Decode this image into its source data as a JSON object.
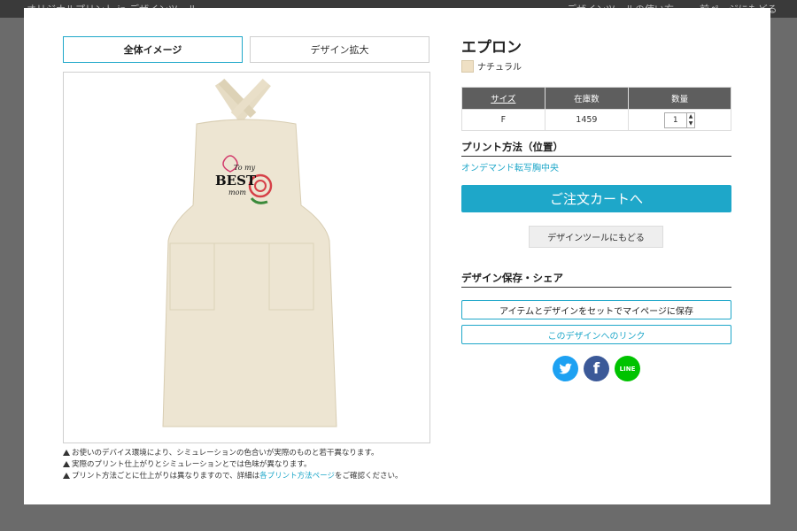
{
  "topbar": {
    "brand": "オリジナルプリント.jp デザインツール",
    "guide": "デザインツールの使い方",
    "back": "前ページにもどる"
  },
  "tabs": {
    "full": "全体イメージ",
    "zoom": "デザイン拡大"
  },
  "preview": {
    "design_text_1": "To my",
    "design_text_2": "BEST",
    "design_text_3": "mom"
  },
  "notes": [
    "お使いのデバイス環境により、シミュレーションの色合いが実際のものと若干異なります。",
    "実際のプリント仕上がりとシミュレーションとでは色味が異なります。"
  ],
  "note3": {
    "before": "プリント方法ごとに仕上がりは異なりますので、詳細は",
    "link": "各プリント方法ページ",
    "after": "をご確認ください。"
  },
  "product": {
    "title": "エプロン",
    "color_name": "ナチュラル"
  },
  "stock_table": {
    "headers": {
      "size": "サイズ",
      "stock": "在庫数",
      "qty": "数量"
    },
    "row": {
      "size": "F",
      "stock": "1459",
      "qty": "1"
    }
  },
  "print": {
    "section_title": "プリント方法（位置）",
    "method": "オンデマンド転写胸中央"
  },
  "cart_button": "ご注文カートへ",
  "back_to_tool": "デザインツールにもどる",
  "save_share": {
    "section_title": "デザイン保存・シェア",
    "save_button": "アイテムとデザインをセットでマイページに保存",
    "link_button": "このデザインへのリンク"
  },
  "social": {
    "twitter": "twitter-icon",
    "facebook": "f",
    "line": "LINE"
  },
  "colors": {
    "accent": "#1ea7c9",
    "twitter": "#1da1f2",
    "facebook": "#3b5998",
    "line": "#00c300"
  }
}
